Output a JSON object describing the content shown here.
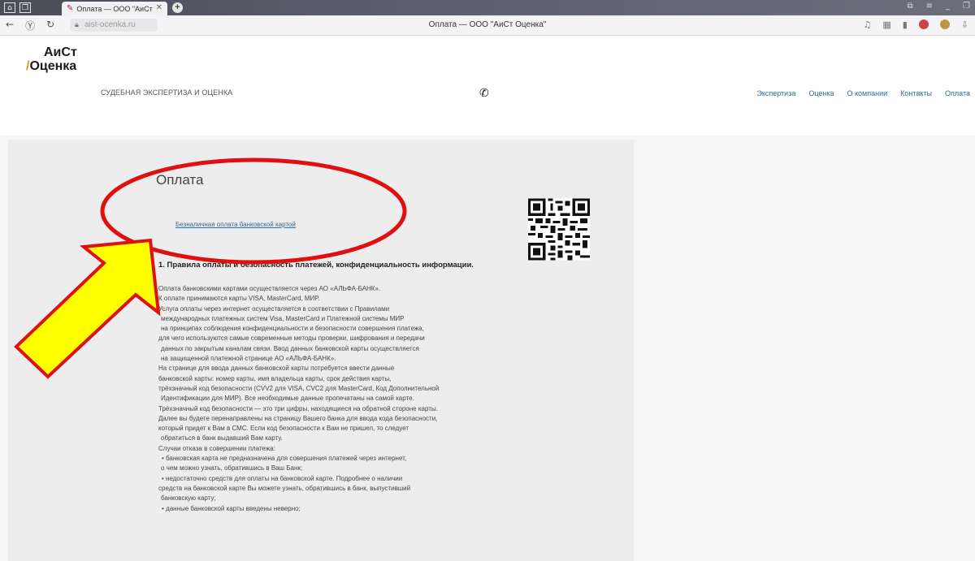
{
  "browser": {
    "tab_title": "Оплата — ООО \"АиСт",
    "tab_close": "✕",
    "new_tab": "+",
    "url": "aist-ocenka.ru",
    "page_title": "Оплата — ООО \"АиСт Оценка\""
  },
  "site": {
    "logo_line1": "АиСт",
    "logo_line2": "Оценка",
    "tagline": "СУДЕБНАЯ ЭКСПЕРТИЗА И ОЦЕНКА",
    "phone_icon": "phone-icon",
    "menu": [
      "Экспертиза",
      "Оценка",
      "О компании",
      "Контакты",
      "Оплата"
    ]
  },
  "main": {
    "title": "Оплата",
    "pay_link": "Безналичная оплата банковской картой",
    "section_heading": "1. Правила оплаты и безопасность платежей, конфиденциальность информации.",
    "lines": [
      "Оплата банковскими картами осуществляется через АО «АЛЬФА-БАНК».",
      "К оплате принимаются карты VISA, MasterCard, МИР.",
      "Услуга оплаты через интернет осуществляется в соответствии с Правилами",
      " международных платежных систем Visa, MasterCard и Платежной системы МИР",
      " на принципах соблюдения конфиденциальности и безопасности совершения платежа,",
      "для чего используются самые современные методы проверки, шифрования и передачи",
      " данных по закрытым каналам связи. Ввод данных банковской карты осуществляется",
      " на защищенной платежной странице АО «АЛЬФА-БАНК».",
      "На странице для ввода данных банковской карты потребуется ввести данные",
      "банковской карты: номер карты, имя владельца карты, срок действия карты,",
      "трёхзначный код безопасности (CVV2 для VISA, CVC2 для MasterCard, Код Дополнительной",
      " Идентификации для МИР). Все необходимые данные пропечатаны на самой карте.",
      "Трёхзначный код безопасности — это три цифры, находящиеся на обратной стороне карты.",
      "Далее вы будете перенаправлены на страницу Вашего банка для ввода кода безопасности,",
      "который придет к Вам в СМС. Если код безопасности к Вам не пришел, то следует",
      " обратиться в банк выдавший Вам карту.",
      "Случаи отказа в совершении платежа:",
      "•      банковская карта не предназначена для совершения платежей через интернет,",
      " о чем можно узнать, обратившись в Ваш Банк;",
      "•      недостаточно средств для оплаты на банковской карте. Подробнее о наличии",
      "средств на банковской карте Вы можете узнать, обратившись в банк, выпустивший",
      " банковскую карту;",
      "•      данные банковской карты введены неверно;"
    ]
  },
  "colors": {
    "annotation_red": "#e01010",
    "annotation_yellow": "#ffff00",
    "link_blue": "#2a6aa0"
  }
}
